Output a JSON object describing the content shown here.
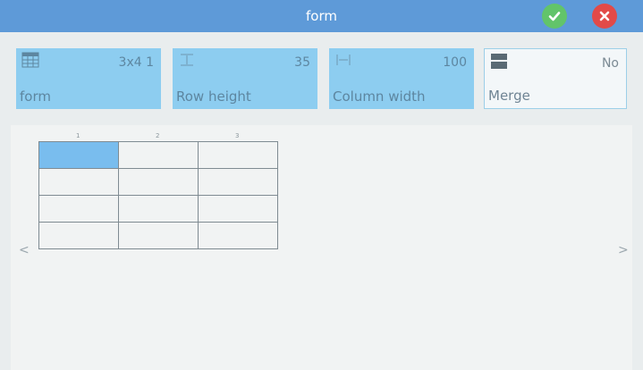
{
  "title": "form",
  "header": {
    "confirm_icon": "check-icon",
    "cancel_icon": "close-icon",
    "confirm_color": "#62c46a",
    "cancel_color": "#e24a48"
  },
  "toolbar": {
    "form": {
      "label": "form",
      "value": "3x4 1",
      "icon": "table-icon"
    },
    "row_height": {
      "label": "Row height",
      "value": "35",
      "icon": "row-height-icon"
    },
    "column_width": {
      "label": "Column width",
      "value": "100",
      "icon": "column-width-icon"
    },
    "merge": {
      "label": "Merge",
      "value": "No",
      "icon": "merge-icon"
    }
  },
  "table": {
    "columns": [
      "1",
      "2",
      "3"
    ],
    "rows": 4,
    "selected_cell": {
      "row": 1,
      "column": 1
    }
  },
  "nav": {
    "prev": "<",
    "next": ">"
  },
  "colors": {
    "accent": "#5e9ad8",
    "tile": "#8dcdf0",
    "selected_cell": "#79bdee"
  }
}
